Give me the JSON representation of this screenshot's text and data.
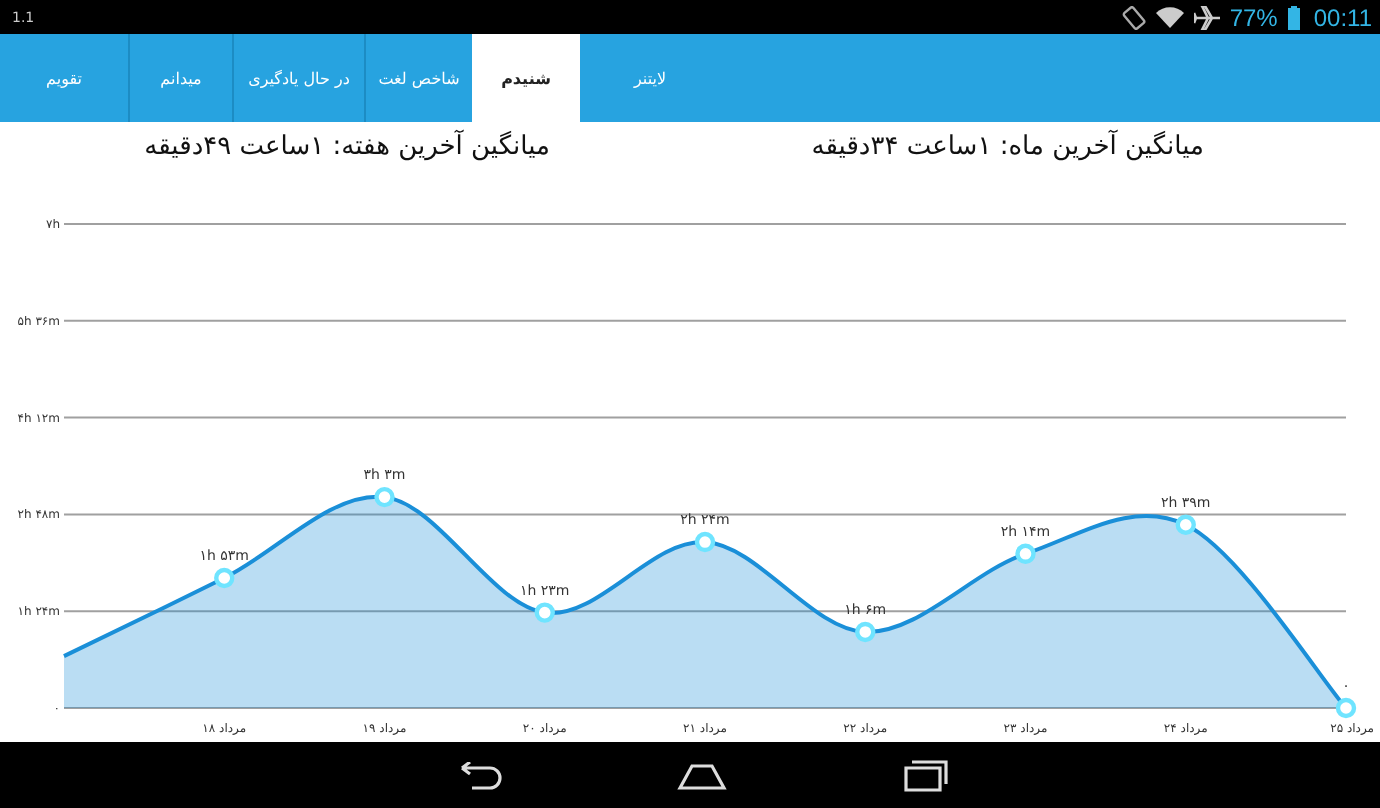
{
  "status_bar": {
    "version": "1.1",
    "battery": "77%",
    "time": "00:11"
  },
  "tabs": [
    {
      "label": "لایتنر",
      "selected": false
    },
    {
      "label": "شنیدم",
      "selected": true
    },
    {
      "label": "شاخص لغت",
      "selected": false
    },
    {
      "label": "در حال یادگیری",
      "selected": false
    },
    {
      "label": "میدانم",
      "selected": false
    },
    {
      "label": "تقویم",
      "selected": false
    }
  ],
  "averages": [
    {
      "text": "میانگین آخرین ماه: ۱ساعت  ۳۴دقیقه"
    },
    {
      "text": "میانگین آخرین هفته: ۱ساعت  ۴۹دقیقه"
    }
  ],
  "chart_data": {
    "type": "area",
    "grid": true,
    "categories": [
      null,
      "۱۸ مرداد",
      "۱۹ مرداد",
      "۲۰ مرداد",
      "۲۱ مرداد",
      "۲۲ مرداد",
      "۲۳ مرداد",
      "۲۴ مرداد",
      "۲۵ مرداد"
    ],
    "series": [
      {
        "color": "#1a8fd8",
        "values": [
          0.75,
          1.88,
          3.05,
          1.38,
          2.4,
          1.1,
          2.23,
          2.65,
          0
        ]
      }
    ],
    "value_labels": [
      null,
      "۱h ۵۳m",
      "۳h ۳m",
      "۱h ۲۳m",
      "۲h ۲۴m",
      "۱h ۶m",
      "۲h ۱۴m",
      "۲h ۳۹m",
      "۰"
    ],
    "ylim": [
      0,
      7
    ],
    "yticks": [
      {
        "value": 0,
        "label": "۰"
      },
      {
        "value": 1.4,
        "label": "۱h ۲۴m"
      },
      {
        "value": 2.8,
        "label": "۲h ۴۸m"
      },
      {
        "value": 4.2,
        "label": "۴h ۱۲m"
      },
      {
        "value": 5.6,
        "label": "۵h ۳۶m"
      },
      {
        "value": 7,
        "label": "۷h"
      }
    ]
  }
}
